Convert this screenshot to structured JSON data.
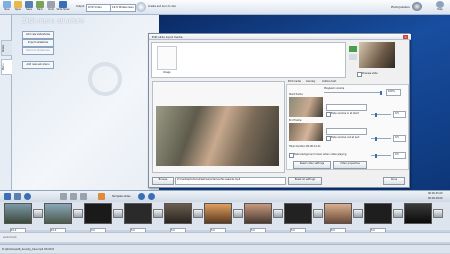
{
  "toolbar": {
    "new": "New",
    "open": "Open",
    "save": "Save",
    "back": "Back",
    "undo": "Undo",
    "slide_show": "Slide Show",
    "output_label": "Output",
    "output_value": "DVD Video",
    "size_value": "16:9 Widescreen",
    "create_label": "Create and burn to disc",
    "brand": "PhotoJukebox",
    "help": "Help"
  },
  "left_tabs": [
    "Slides",
    "Menu"
  ],
  "menu_panel": {
    "title": "Disk menu structure",
    "buttons": [
      "Add new slideshows",
      "Import slideshow",
      "Remove slideshows",
      "Add new sub-menu"
    ]
  },
  "dialog": {
    "title": "Edit slide input media",
    "image_label": "Image",
    "preview_label": "Preview slide",
    "tabs": [
      "Edit media",
      "Overlay",
      "Outline text"
    ],
    "playback_volume_label": "Playback volume",
    "playback_volume_value": "100%",
    "start_frame_label": "Start frame",
    "end_frame_label": "End frame",
    "fade_start_label": "Fade volume in at start",
    "fade_end_label": "Fade volume out at end",
    "fade_start_value": "0.5",
    "fade_end_value": "0.5",
    "total_duration_label": "Total duration 00:00:14.11",
    "fade_bg_label": "Fade background music when video playing",
    "fade_bg_value": "0.5",
    "reset_video_btn": "Reset video settings",
    "video_properties_btn": "Video properties",
    "browse_btn": "Browse",
    "file_path": "Z:\\media\\photos\\slideshow\\video\\surfer-seaside.mp4",
    "reset_all_btn": "Reset all settings",
    "done_btn": "Done"
  },
  "timeline": {
    "template_label": "Template slides",
    "time_label": "00:00:25.00",
    "time_label2": "00:00:18.00",
    "durations": [
      "10.0",
      "10.0",
      "4.0",
      "5.0",
      "5.0",
      "5.0",
      "5.0",
      "5.0",
      "6.0",
      "5.0"
    ]
  },
  "audio": {
    "label": "Audio track"
  },
  "status": {
    "text": "D:\\photos\\edit_bounty_has.mp4  00:00:0"
  },
  "colors": {
    "bg_blue": "#184ea0",
    "accent": "#3a6fb8"
  }
}
